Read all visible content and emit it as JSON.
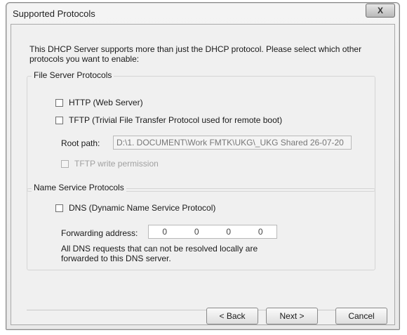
{
  "window": {
    "title": "Supported Protocols",
    "close_label": "X"
  },
  "intro": "This DHCP Server supports more than just the DHCP protocol. Please select which other protocols you want to enable:",
  "file_server_group": {
    "label": "File Server Protocols",
    "http_label": "HTTP (Web Server)",
    "http_checked": false,
    "tftp_label": "TFTP (Trivial File Transfer Protocol used for remote boot)",
    "tftp_checked": false,
    "root_path_label": "Root path:",
    "root_path_value": "D:\\1. DOCUMENT\\Work FMTK\\UKG\\_UKG Shared 26-07-20",
    "tftp_write_label": "TFTP write permission",
    "tftp_write_checked": false
  },
  "name_service_group": {
    "label": "Name Service Protocols",
    "dns_label": "DNS (Dynamic Name Service Protocol)",
    "dns_checked": false,
    "forwarding_label": "Forwarding address:",
    "forwarding_octets": [
      "0",
      "0",
      "0",
      "0"
    ],
    "note": "All DNS requests that can not be resolved locally are forwarded to this DNS server."
  },
  "buttons": {
    "back": "< Back",
    "next": "Next >",
    "cancel": "Cancel"
  }
}
